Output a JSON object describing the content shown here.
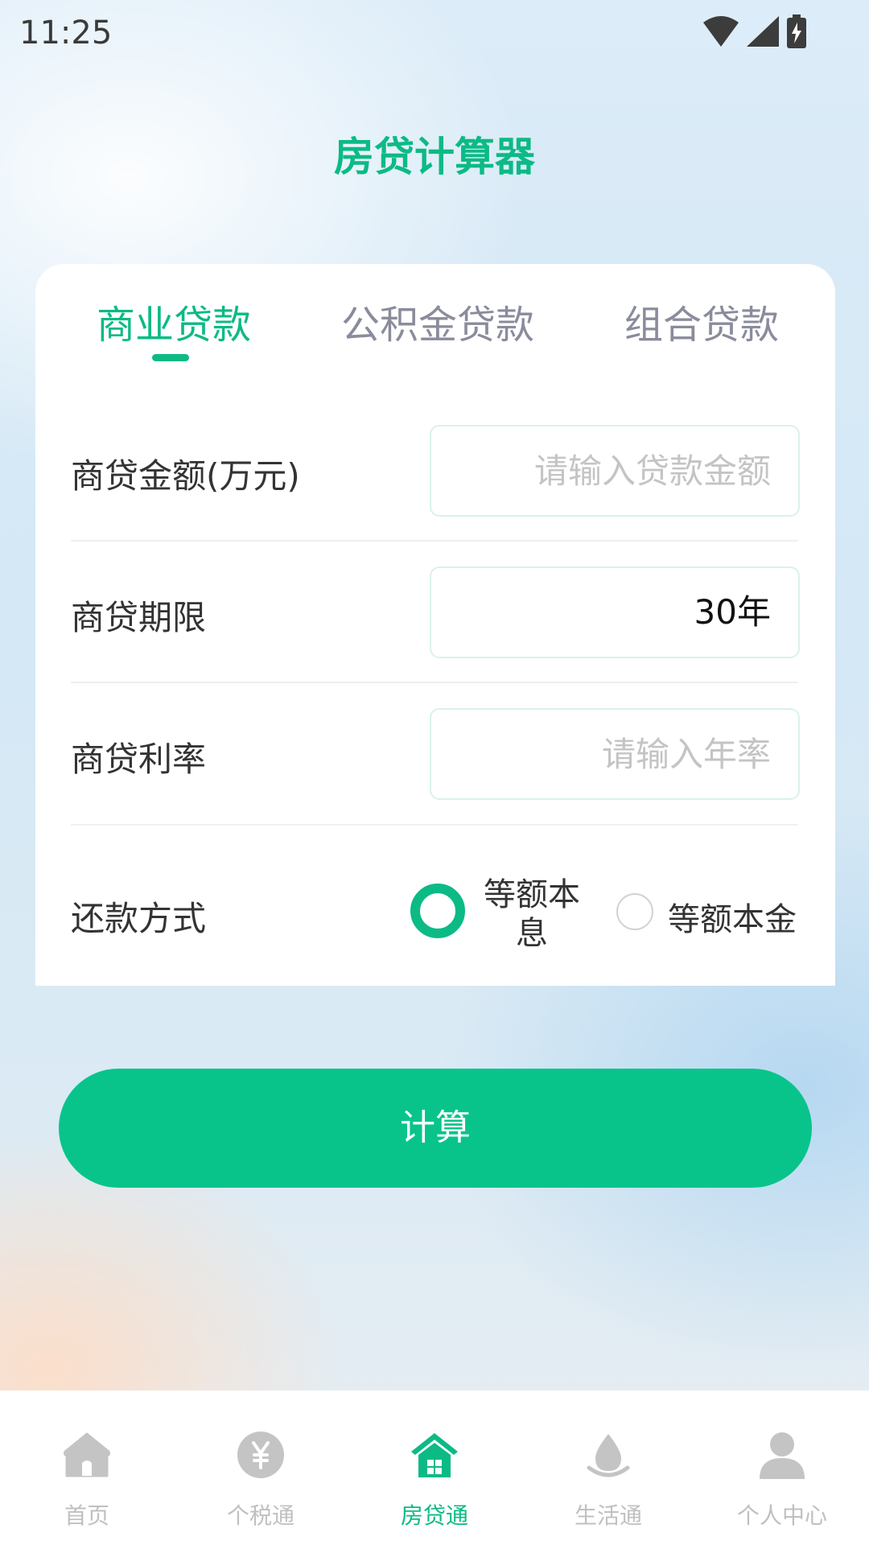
{
  "status_bar": {
    "time": "11:25",
    "icons": [
      "wifi-icon",
      "cell-signal-icon",
      "battery-charging-icon"
    ]
  },
  "header": {
    "title": "房贷计算器"
  },
  "tabs": [
    {
      "label": "商业贷款",
      "active": true
    },
    {
      "label": "公积金贷款",
      "active": false
    },
    {
      "label": "组合贷款",
      "active": false
    }
  ],
  "form": {
    "amount": {
      "label": "商贷金额(万元)",
      "value": "",
      "placeholder": "请输入贷款金额"
    },
    "term": {
      "label": "商贷期限",
      "value": "30年"
    },
    "rate": {
      "label": "商贷利率",
      "value": "",
      "placeholder": "请输入年率"
    },
    "repayment": {
      "label": "还款方式",
      "options": [
        {
          "label": "等额本息",
          "selected": true
        },
        {
          "label": "等额本金",
          "selected": false
        }
      ]
    }
  },
  "calculate_button": {
    "label": "计算"
  },
  "bottom_nav": {
    "items": [
      {
        "label": "首页",
        "icon": "home-icon",
        "active": false
      },
      {
        "label": "个税通",
        "icon": "yuan-coin-icon",
        "active": false
      },
      {
        "label": "房贷通",
        "icon": "house-icon",
        "active": true
      },
      {
        "label": "生活通",
        "icon": "water-drop-icon",
        "active": false
      },
      {
        "label": "个人中心",
        "icon": "person-icon",
        "active": false
      }
    ]
  },
  "colors": {
    "accent": "#0cba85",
    "button": "#08c48b",
    "inactive": "#c0c0c0",
    "tab_inactive": "#8a8c9c"
  }
}
